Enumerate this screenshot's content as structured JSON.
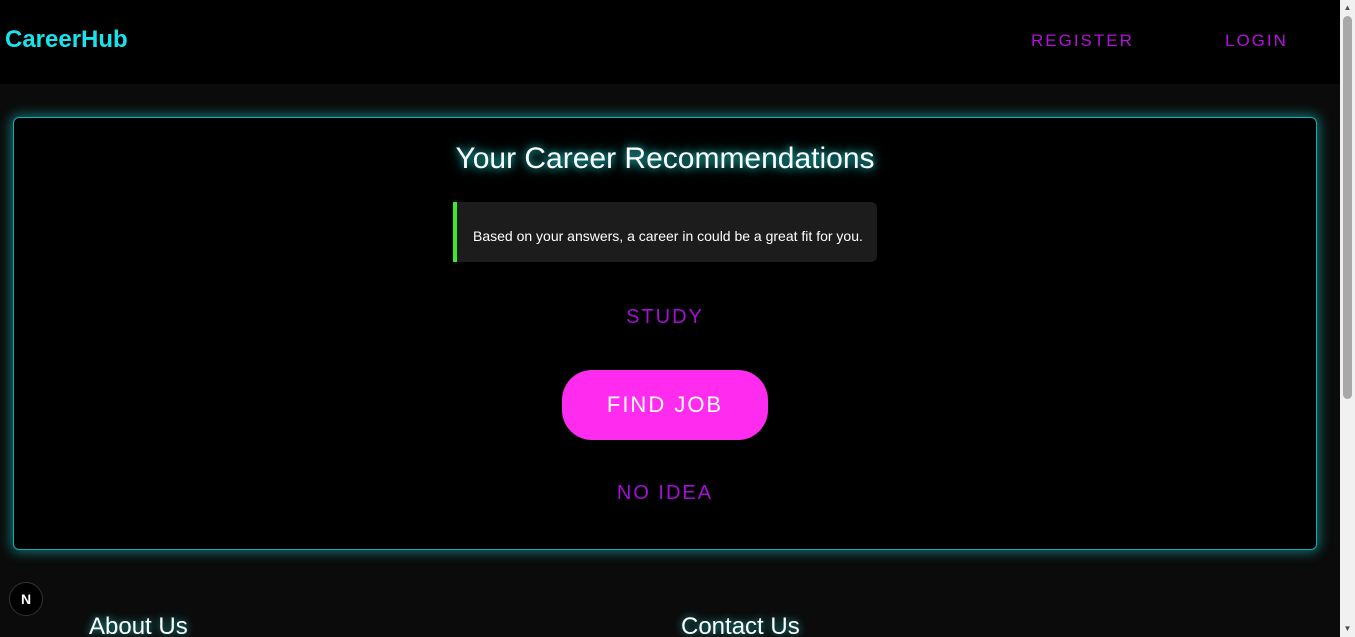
{
  "header": {
    "brand": "CareerHub",
    "nav": {
      "register": "REGISTER",
      "login": "LOGIN"
    }
  },
  "recommendations": {
    "title": "Your Career Recommendations",
    "message": "Based on your answers, a career in could be a great fit for you.",
    "options": {
      "study": "STUDY",
      "find_job": "FIND JOB",
      "no_idea": "NO IDEA"
    }
  },
  "badge": {
    "letter": "N",
    "icon": "nextjs-logo-icon"
  },
  "footer": {
    "about_heading": "About Us",
    "contact_heading": "Contact Us"
  },
  "colors": {
    "brand": "#19e3ea",
    "nav_link": "#b012d8",
    "accent_button": "#ff2cf0",
    "message_border": "#3aea2a",
    "card_glow": "#1fa9a9"
  }
}
